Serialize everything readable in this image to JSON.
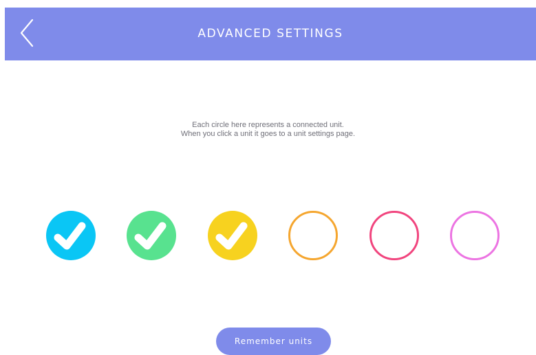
{
  "header": {
    "title": "ADVANCED SETTINGS",
    "back_icon": "chevron-left-icon",
    "background_color": "#7f8bea",
    "text_color": "#ffffff"
  },
  "description": {
    "line1": "Each circle here represents a connected unit.",
    "line2": "When you click a unit it goes to a unit settings page."
  },
  "units": [
    {
      "color": "#0ac6f5",
      "checked": true
    },
    {
      "color": "#58e28f",
      "checked": true
    },
    {
      "color": "#f7d21f",
      "checked": true
    },
    {
      "color": "#f5a62f",
      "checked": false
    },
    {
      "color": "#f1457e",
      "checked": false
    },
    {
      "color": "#ec74e2",
      "checked": false
    }
  ],
  "footer": {
    "remember_label": "Remember units",
    "button_color": "#7f8bea"
  }
}
